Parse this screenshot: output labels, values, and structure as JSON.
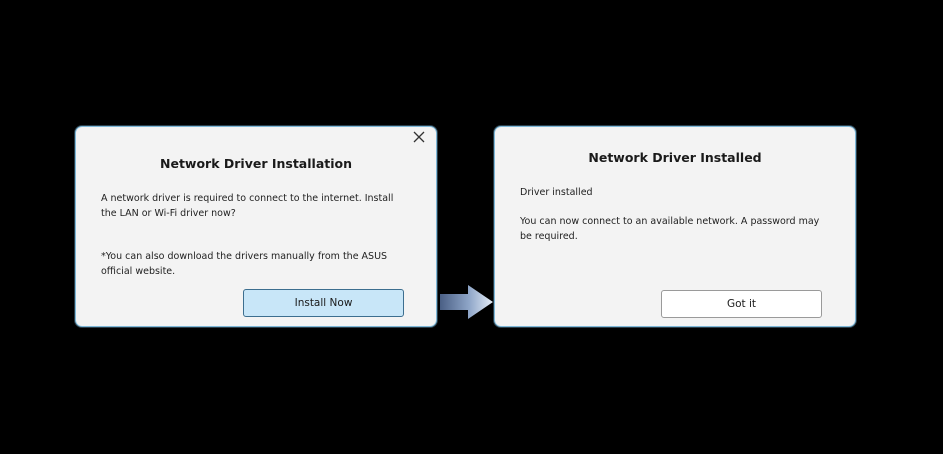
{
  "left_dialog": {
    "title": "Network Driver Installation",
    "body_1": "A network driver is required to connect to the internet. Install the LAN or Wi-Fi driver now?",
    "body_2": "*You can also download the drivers manually from the ASUS official website.",
    "primary_button": "Install Now",
    "close_icon": "close-icon"
  },
  "right_dialog": {
    "title": "Network Driver Installed",
    "body_1": "Driver installed",
    "body_2": "You can now connect to an available network. A password may be required.",
    "primary_button": "Got it"
  },
  "transition_icon": "arrow-right-icon",
  "colors": {
    "background": "#000000",
    "dialog_bg": "#f3f3f3",
    "dialog_border": "#7fb8d8",
    "primary_button_bg": "#c8e6f8",
    "primary_button_border": "#3c6e8f",
    "secondary_button_bg": "#ffffff",
    "arrow_light": "#dfe9f5",
    "arrow_dark": "#5b74a0"
  }
}
